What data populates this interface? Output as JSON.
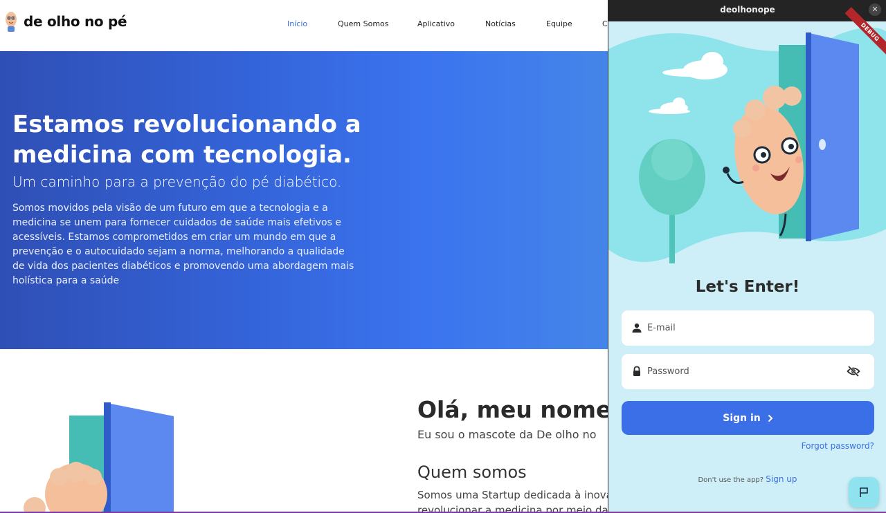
{
  "site": {
    "logo_text": "de olho no pé",
    "nav": [
      {
        "label": "Início",
        "active": true
      },
      {
        "label": "Quem Somos",
        "active": false
      },
      {
        "label": "Aplicativo",
        "active": false
      },
      {
        "label": "Notícias",
        "active": false
      },
      {
        "label": "Equipe",
        "active": false
      },
      {
        "label": "C",
        "active": false
      }
    ],
    "hero": {
      "title": "Estamos revolucionando a medicina com tecnologia.",
      "subtitle": "Um caminho para a prevenção do pé diabético.",
      "body": "Somos movidos pela visão de um futuro em que a tecnologia e a medicina se unem para fornecer cuidados de saúde mais efetivos e acessíveis. Estamos comprometidos em criar um mundo em que a prevenção e o autocuidado sejam a norma, melhorando a qualidade de vida dos pacientes diabéticos e promovendo uma abordagem mais holística para a saúde"
    },
    "about": {
      "hello": "Olá, meu nome",
      "mascot_line": "Eu sou o mascote da De olho no",
      "heading": "Quem somos",
      "text": "Somos uma Startup dedicada à inovação em revolucionar a medicina por meio da"
    },
    "accent_color": "#3d6fe4"
  },
  "app": {
    "window_title": "deolhonope",
    "debug_label": "DEBUG",
    "heading": "Let's Enter!",
    "email_placeholder": "E-mail",
    "password_placeholder": "Password",
    "signin_label": "Sign in",
    "forgot_label": "Forgot password?",
    "signup_prompt": "Don't use the app? ",
    "signup_link": "Sign up",
    "primary_color": "#3a6fe8",
    "background_color": "#cfeff8"
  }
}
